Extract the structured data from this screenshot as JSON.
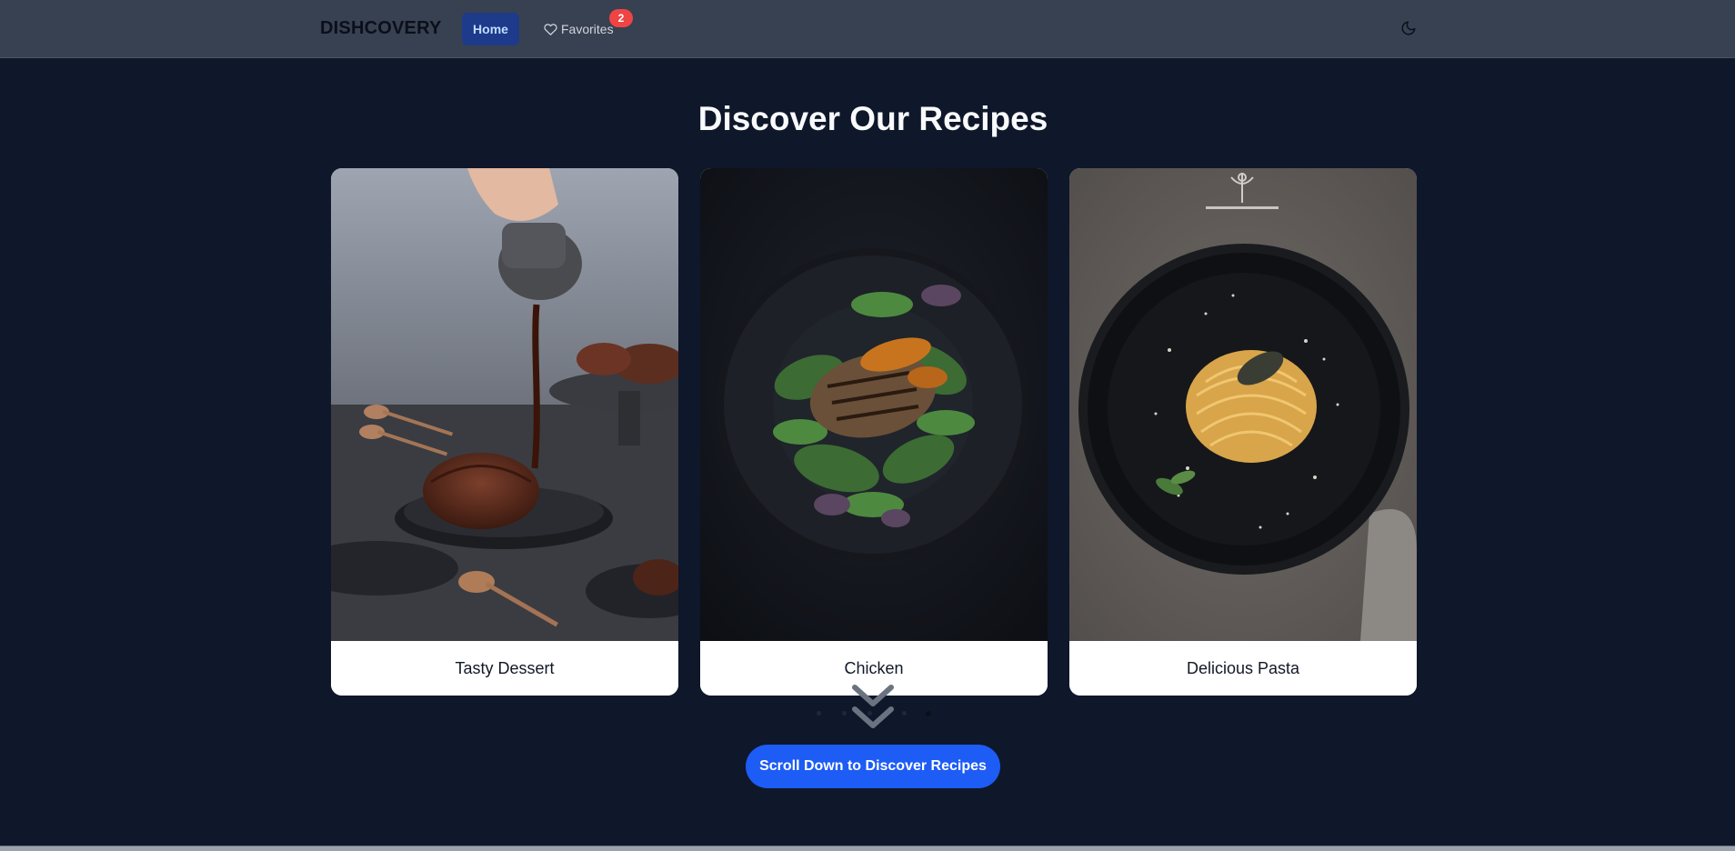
{
  "navbar": {
    "brand": "DISHCOVERY",
    "home_label": "Home",
    "favorites_label": "Favorites",
    "favorites_count": "2",
    "theme_icon": "moon-icon"
  },
  "hero": {
    "title": "Discover Our Recipes"
  },
  "carousel": {
    "cards": [
      {
        "label": "Tasty Dessert",
        "image": "chocolate-lava-cake-photo"
      },
      {
        "label": "Chicken",
        "image": "grilled-chicken-salad-photo"
      },
      {
        "label": "Delicious Pasta",
        "image": "pasta-plate-photo"
      }
    ],
    "dots_count": 5,
    "active_dot": 4
  },
  "cta": {
    "label": "Scroll Down to Discover Recipes",
    "icon": "chevrons-down-icon"
  },
  "colors": {
    "background": "#0f172a",
    "navbar": "#374151",
    "home_active": "#1e3a8a",
    "badge": "#ef4444",
    "cta": "#1d5cf5"
  }
}
